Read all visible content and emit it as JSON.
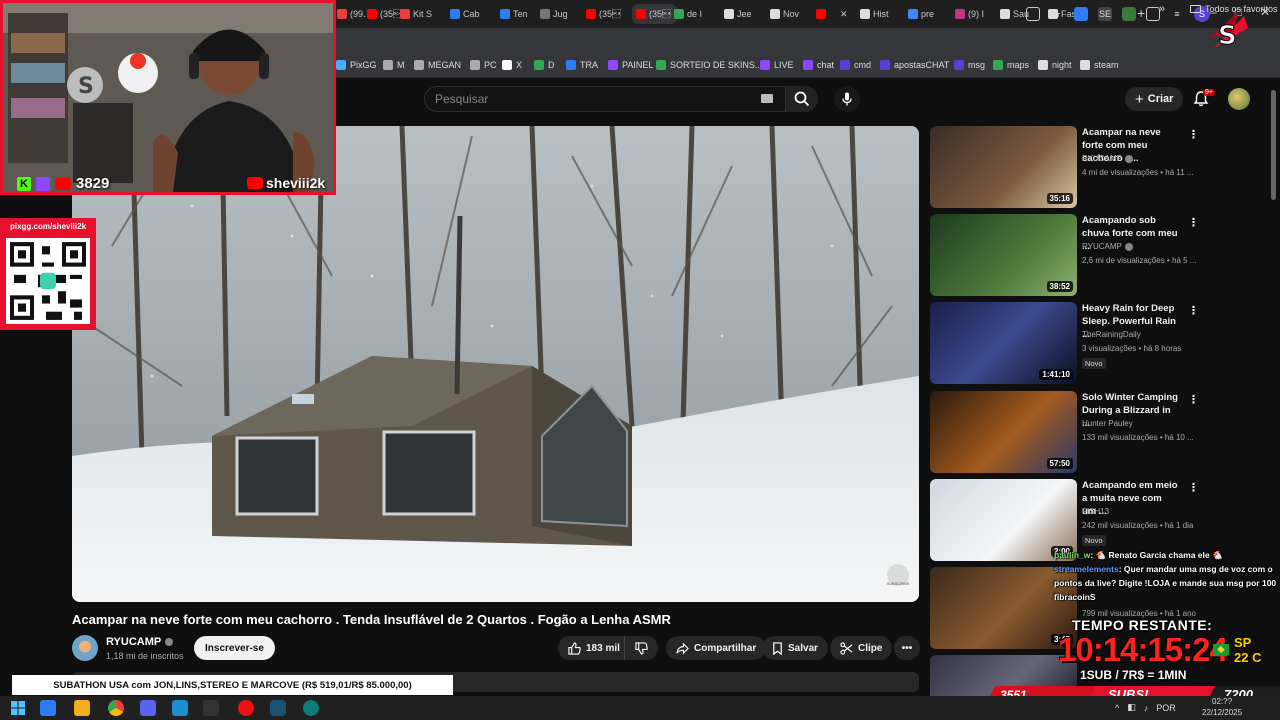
{
  "browser": {
    "tabs": [
      {
        "label": "(99…",
        "color": "#e83e3e"
      },
      {
        "label": "(35\u0014",
        "color": "#ff0000"
      },
      {
        "label": "Kit S",
        "color": "#e83e3e"
      },
      {
        "label": "Cab",
        "color": "#2f7df5"
      },
      {
        "label": "Ten",
        "color": "#2f7df5"
      },
      {
        "label": "Jug",
        "color": "#777777"
      },
      {
        "label": "(35\u0014",
        "color": "#ff0000"
      },
      {
        "label": "(35\u0014",
        "color": "#ff0000"
      },
      {
        "label": "de I",
        "color": "#34a853"
      },
      {
        "label": "Jee",
        "color": "#dddddd"
      },
      {
        "label": "Nov",
        "color": "#dddddd"
      },
      {
        "label": "",
        "color": "#ff0000"
      },
      {
        "label": "Hist",
        "color": "#dddddd"
      },
      {
        "label": "pre",
        "color": "#4285f4"
      },
      {
        "label": "(9) I",
        "color": "#c13584"
      },
      {
        "label": "Sau",
        "color": "#dddddd"
      },
      {
        "label": "Fast",
        "color": "#dddddd"
      }
    ],
    "new_tab_label": "+",
    "close_tab_label": "✕",
    "window_controls": [
      "—",
      "□",
      "✕"
    ]
  },
  "bookmarks": {
    "items": [
      {
        "label": "PixGG",
        "color": "#3fb1ff"
      },
      {
        "label": "M",
        "color": "#aaaaaa"
      },
      {
        "label": "MEGAN",
        "color": "#aaaaaa"
      },
      {
        "label": "PC",
        "color": "#aaaaaa"
      },
      {
        "label": "X",
        "color": "#ffffff"
      },
      {
        "label": "D",
        "color": "#34a853"
      },
      {
        "label": "TRA",
        "color": "#2f7df5"
      },
      {
        "label": "PAINEL",
        "color": "#9146ff"
      },
      {
        "label": "SORTEIO DE SKINS...",
        "color": "#34a853"
      },
      {
        "label": "LIVE",
        "color": "#9146ff"
      },
      {
        "label": "chat",
        "color": "#9146ff"
      },
      {
        "label": "cmd",
        "color": "#5a3fd6"
      },
      {
        "label": "apostasCHAT",
        "color": "#5a3fd6"
      },
      {
        "label": "msg",
        "color": "#5a3fd6"
      },
      {
        "label": "maps",
        "color": "#34a853"
      },
      {
        "label": "night",
        "color": "#dddddd"
      },
      {
        "label": "steam",
        "color": "#dddddd"
      }
    ],
    "more_label": "»",
    "all_label": "Todos os favoritos"
  },
  "youtube_header": {
    "search_placeholder": "Pesquisar",
    "create_label": "Criar",
    "notification_count": "9+"
  },
  "video": {
    "title": "Acampar na neve forte com meu cachorro . Tenda Insuflável de 2 Quartos . Fogão a Lenha ASMR",
    "channel_name": "RYUCAMP",
    "channel_subs": "1,18 mi de inscritos",
    "subscribe_label": "Inscrever-se",
    "likes": "183 mil",
    "share_label": "Compartilhar",
    "save_label": "Salvar",
    "clip_label": "Clipe",
    "watermark_label": "SUBSCRIBE"
  },
  "recommendations": [
    {
      "title": "Acampar na neve forte com meu cachorro . ...",
      "channel": "RYUCAMP",
      "verified": true,
      "meta": "4 mi de visualizações • há 11 ...",
      "duration": "35:16",
      "badge": ""
    },
    {
      "title": "Acampando sob chuva forte com meu ...",
      "channel": "RYUCAMP",
      "verified": true,
      "meta": "2,6 mi de visualizações • há 5 ...",
      "duration": "38:52",
      "badge": ""
    },
    {
      "title": "Heavy Rain for Deep Sleep. Powerful Rain ...",
      "channel": "TheRainingDaily",
      "verified": false,
      "meta": "3 visualizações • há 8 horas",
      "duration": "1:41:10",
      "badge": "Novo"
    },
    {
      "title": "Solo Winter Camping During a Blizzard in ...",
      "channel": "Hunter Pauley",
      "verified": false,
      "meta": "133 mil visualizações • há 10 ...",
      "duration": "57:50",
      "badge": ""
    },
    {
      "title": "Acampando em meio a muita neve com um ...",
      "channel": "FISH13",
      "verified": false,
      "meta": "242 mil visualizações • há 1 dia",
      "duration": "2:00",
      "badge": "Novo"
    },
    {
      "title": "",
      "channel": "",
      "verified": false,
      "meta": "799 mil visualizações • há 1 ano",
      "duration": "3:45",
      "badge": ""
    },
    {
      "title": "",
      "channel": "",
      "verified": false,
      "meta": "",
      "duration": "",
      "badge": ""
    }
  ],
  "stream": {
    "kick_count": "3829",
    "handle": "sheviii2k",
    "qr_url": "pixgg.com/sheviii2k",
    "chat": [
      {
        "user": "paulin_w",
        "text": ": 🐔 Renato Garcia chama ele 🐔"
      },
      {
        "user": "streamelements",
        "text": ": Quer mandar uma msg de voz com o pontos da live? Digite !LOJA e mande sua msg por 100 fibracoinS"
      }
    ],
    "timer_label": "TEMPO RESTANTE:",
    "timer_value": "10:14:15:24",
    "weather_city": "SP",
    "weather_temp": "22 C",
    "sub_rule": "1SUB / 7R$ = 1MIN",
    "sub_count_left": "3551",
    "sub_label": "SUBS!",
    "sub_count_right": "7200",
    "subathon_banner": "SUBATHON USA com JON,LINS,STEREO E MARCOVE (R$ 519,01/R$ 85.000,00)",
    "accent_color": "#e8112d"
  },
  "taskbar": {
    "tray_lang": "POR",
    "clock_time": "02:??",
    "clock_date": "22/12/2025"
  }
}
